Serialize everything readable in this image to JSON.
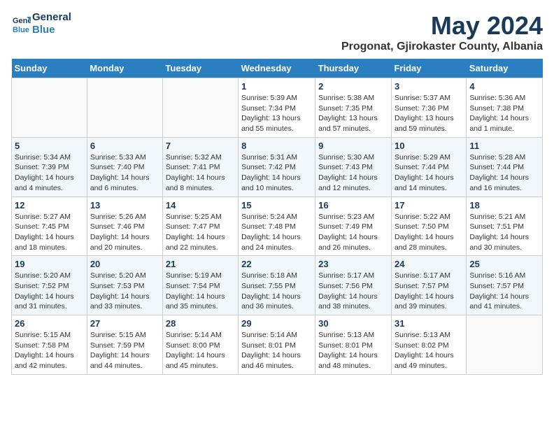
{
  "header": {
    "logo_line1": "General",
    "logo_line2": "Blue",
    "month_title": "May 2024",
    "location": "Progonat, Gjirokaster County, Albania"
  },
  "days_of_week": [
    "Sunday",
    "Monday",
    "Tuesday",
    "Wednesday",
    "Thursday",
    "Friday",
    "Saturday"
  ],
  "weeks": [
    [
      {
        "day": "",
        "info": ""
      },
      {
        "day": "",
        "info": ""
      },
      {
        "day": "",
        "info": ""
      },
      {
        "day": "1",
        "info": "Sunrise: 5:39 AM\nSunset: 7:34 PM\nDaylight: 13 hours\nand 55 minutes."
      },
      {
        "day": "2",
        "info": "Sunrise: 5:38 AM\nSunset: 7:35 PM\nDaylight: 13 hours\nand 57 minutes."
      },
      {
        "day": "3",
        "info": "Sunrise: 5:37 AM\nSunset: 7:36 PM\nDaylight: 13 hours\nand 59 minutes."
      },
      {
        "day": "4",
        "info": "Sunrise: 5:36 AM\nSunset: 7:38 PM\nDaylight: 14 hours\nand 1 minute."
      }
    ],
    [
      {
        "day": "5",
        "info": "Sunrise: 5:34 AM\nSunset: 7:39 PM\nDaylight: 14 hours\nand 4 minutes."
      },
      {
        "day": "6",
        "info": "Sunrise: 5:33 AM\nSunset: 7:40 PM\nDaylight: 14 hours\nand 6 minutes."
      },
      {
        "day": "7",
        "info": "Sunrise: 5:32 AM\nSunset: 7:41 PM\nDaylight: 14 hours\nand 8 minutes."
      },
      {
        "day": "8",
        "info": "Sunrise: 5:31 AM\nSunset: 7:42 PM\nDaylight: 14 hours\nand 10 minutes."
      },
      {
        "day": "9",
        "info": "Sunrise: 5:30 AM\nSunset: 7:43 PM\nDaylight: 14 hours\nand 12 minutes."
      },
      {
        "day": "10",
        "info": "Sunrise: 5:29 AM\nSunset: 7:44 PM\nDaylight: 14 hours\nand 14 minutes."
      },
      {
        "day": "11",
        "info": "Sunrise: 5:28 AM\nSunset: 7:44 PM\nDaylight: 14 hours\nand 16 minutes."
      }
    ],
    [
      {
        "day": "12",
        "info": "Sunrise: 5:27 AM\nSunset: 7:45 PM\nDaylight: 14 hours\nand 18 minutes."
      },
      {
        "day": "13",
        "info": "Sunrise: 5:26 AM\nSunset: 7:46 PM\nDaylight: 14 hours\nand 20 minutes."
      },
      {
        "day": "14",
        "info": "Sunrise: 5:25 AM\nSunset: 7:47 PM\nDaylight: 14 hours\nand 22 minutes."
      },
      {
        "day": "15",
        "info": "Sunrise: 5:24 AM\nSunset: 7:48 PM\nDaylight: 14 hours\nand 24 minutes."
      },
      {
        "day": "16",
        "info": "Sunrise: 5:23 AM\nSunset: 7:49 PM\nDaylight: 14 hours\nand 26 minutes."
      },
      {
        "day": "17",
        "info": "Sunrise: 5:22 AM\nSunset: 7:50 PM\nDaylight: 14 hours\nand 28 minutes."
      },
      {
        "day": "18",
        "info": "Sunrise: 5:21 AM\nSunset: 7:51 PM\nDaylight: 14 hours\nand 30 minutes."
      }
    ],
    [
      {
        "day": "19",
        "info": "Sunrise: 5:20 AM\nSunset: 7:52 PM\nDaylight: 14 hours\nand 31 minutes."
      },
      {
        "day": "20",
        "info": "Sunrise: 5:20 AM\nSunset: 7:53 PM\nDaylight: 14 hours\nand 33 minutes."
      },
      {
        "day": "21",
        "info": "Sunrise: 5:19 AM\nSunset: 7:54 PM\nDaylight: 14 hours\nand 35 minutes."
      },
      {
        "day": "22",
        "info": "Sunrise: 5:18 AM\nSunset: 7:55 PM\nDaylight: 14 hours\nand 36 minutes."
      },
      {
        "day": "23",
        "info": "Sunrise: 5:17 AM\nSunset: 7:56 PM\nDaylight: 14 hours\nand 38 minutes."
      },
      {
        "day": "24",
        "info": "Sunrise: 5:17 AM\nSunset: 7:57 PM\nDaylight: 14 hours\nand 39 minutes."
      },
      {
        "day": "25",
        "info": "Sunrise: 5:16 AM\nSunset: 7:57 PM\nDaylight: 14 hours\nand 41 minutes."
      }
    ],
    [
      {
        "day": "26",
        "info": "Sunrise: 5:15 AM\nSunset: 7:58 PM\nDaylight: 14 hours\nand 42 minutes."
      },
      {
        "day": "27",
        "info": "Sunrise: 5:15 AM\nSunset: 7:59 PM\nDaylight: 14 hours\nand 44 minutes."
      },
      {
        "day": "28",
        "info": "Sunrise: 5:14 AM\nSunset: 8:00 PM\nDaylight: 14 hours\nand 45 minutes."
      },
      {
        "day": "29",
        "info": "Sunrise: 5:14 AM\nSunset: 8:01 PM\nDaylight: 14 hours\nand 46 minutes."
      },
      {
        "day": "30",
        "info": "Sunrise: 5:13 AM\nSunset: 8:01 PM\nDaylight: 14 hours\nand 48 minutes."
      },
      {
        "day": "31",
        "info": "Sunrise: 5:13 AM\nSunset: 8:02 PM\nDaylight: 14 hours\nand 49 minutes."
      },
      {
        "day": "",
        "info": ""
      }
    ]
  ]
}
